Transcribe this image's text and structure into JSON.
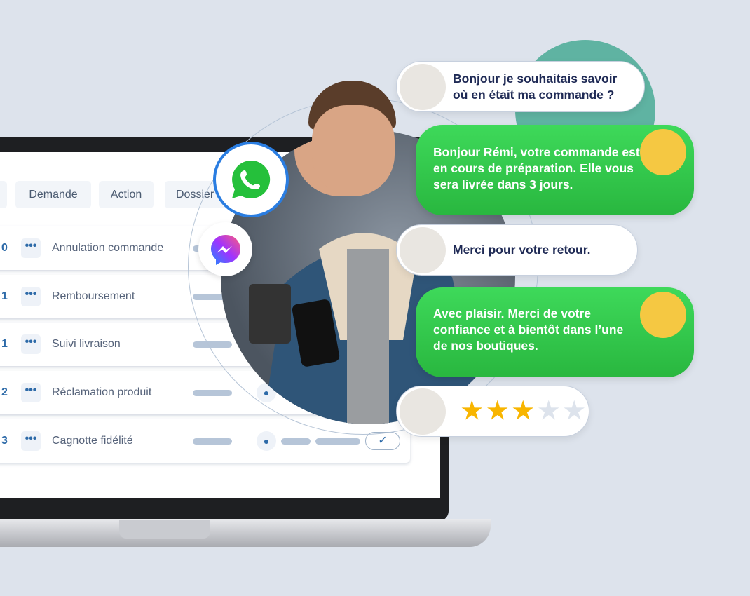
{
  "table": {
    "headers": [
      "Demande",
      "Action",
      "Dossier"
    ],
    "rows": [
      {
        "num": "0",
        "label": "Annulation commande"
      },
      {
        "num": "1",
        "label": "Remboursement"
      },
      {
        "num": "1",
        "label": "Suivi livraison"
      },
      {
        "num": "2",
        "label": "Réclamation produit"
      },
      {
        "num": "3",
        "label": "Cagnotte fidélité"
      }
    ],
    "dots": "•••",
    "check": "✓"
  },
  "channels": [
    "whatsapp-icon",
    "messenger-icon"
  ],
  "chat": {
    "messages": [
      {
        "from": "customer",
        "text": "Bonjour je souhaitais savoir où en était ma commande ?"
      },
      {
        "from": "agent",
        "text": "Bonjour Rémi, votre commande est en cours de préparation. Elle vous sera livrée dans 3 jours."
      },
      {
        "from": "customer",
        "text": "Merci pour votre retour."
      },
      {
        "from": "agent",
        "text": "Avec plaisir. Merci de votre confiance et à bientôt dans l’une de nos boutiques."
      }
    ],
    "rating": {
      "value": 3,
      "max": 5
    }
  },
  "colors": {
    "accent_green": "#2fc74a",
    "teal": "#5fb3a2",
    "star": "#f8b500",
    "star_empty": "#dde3ec",
    "text_dark": "#1f2a55"
  }
}
